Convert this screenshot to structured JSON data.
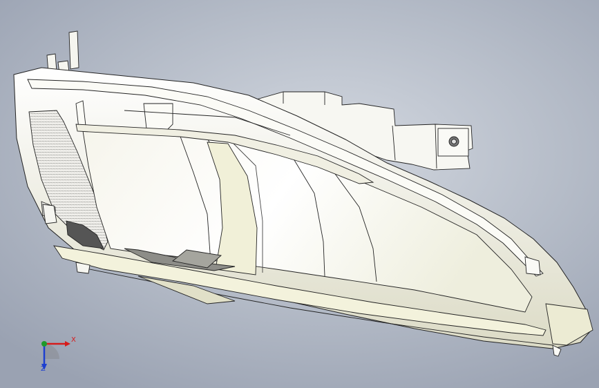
{
  "viewport": {
    "background": [
      "#d3d8e0",
      "#9aa2b2"
    ],
    "model": {
      "description_icon": "headlamp-housing-3d-model",
      "body_color": "#ffffff",
      "shade_color": "#efeedd",
      "edge_color": "#222222"
    }
  },
  "triad": {
    "x_label": "X",
    "z_label": "Z",
    "x_color": "#d61b1b",
    "y_color": "#1f9a2a",
    "z_color": "#1d3fd0"
  }
}
